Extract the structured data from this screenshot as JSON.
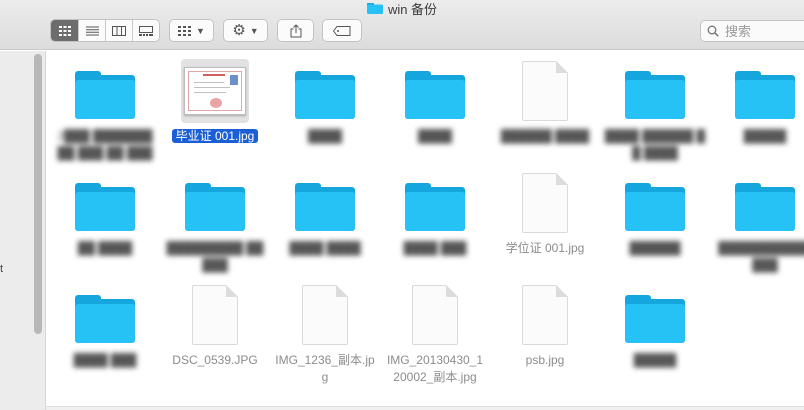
{
  "window": {
    "title": "win 备份"
  },
  "toolbar": {
    "view_modes": [
      "icon-view",
      "list-view",
      "column-view",
      "gallery-view"
    ],
    "active_view": 0,
    "group_button": "group-by",
    "action_button": "gear",
    "share_button": "share",
    "tag_button": "tag"
  },
  "search": {
    "placeholder": "搜索",
    "value": ""
  },
  "sidebar": {
    "fragment": "t"
  },
  "files": [
    {
      "type": "folder",
      "name": "2███ ███████ ██ ███ ██ ███",
      "blurred": true
    },
    {
      "type": "image",
      "name": "毕业证 001.jpg",
      "selected": true,
      "thumbnail": "certificate"
    },
    {
      "type": "folder",
      "name": "████",
      "blurred": true
    },
    {
      "type": "folder",
      "name": "████",
      "blurred": true
    },
    {
      "type": "document",
      "name": "██████ ████",
      "blurred": true
    },
    {
      "type": "folder",
      "name": "████ ██████ ██ ████",
      "blurred": true
    },
    {
      "type": "folder",
      "name": "█████",
      "blurred": true
    },
    {
      "type": "folder",
      "name": "██ ████",
      "blurred": true
    },
    {
      "type": "folder",
      "name": "█████████ █████",
      "blurred": true
    },
    {
      "type": "folder",
      "name": "████ ████",
      "blurred": true
    },
    {
      "type": "folder",
      "name": "████ ███",
      "blurred": true
    },
    {
      "type": "document",
      "name": "学位证 001.jpg"
    },
    {
      "type": "folder",
      "name": "██████",
      "blurred": true
    },
    {
      "type": "folder",
      "name": "███████████ ███",
      "blurred": true
    },
    {
      "type": "folder",
      "name": "████ ███",
      "blurred": true
    },
    {
      "type": "document",
      "name": "DSC_0539.JPG"
    },
    {
      "type": "document",
      "name": "IMG_1236_副本.jpg"
    },
    {
      "type": "document",
      "name": "IMG_20130430_120002_副本.jpg"
    },
    {
      "type": "document",
      "name": "psb.jpg"
    },
    {
      "type": "folder",
      "name": "█████",
      "blurred": true
    }
  ],
  "colors": {
    "folder_front": "#26c2f6",
    "folder_back": "#14a6dd",
    "selection": "#1b5fd6"
  }
}
